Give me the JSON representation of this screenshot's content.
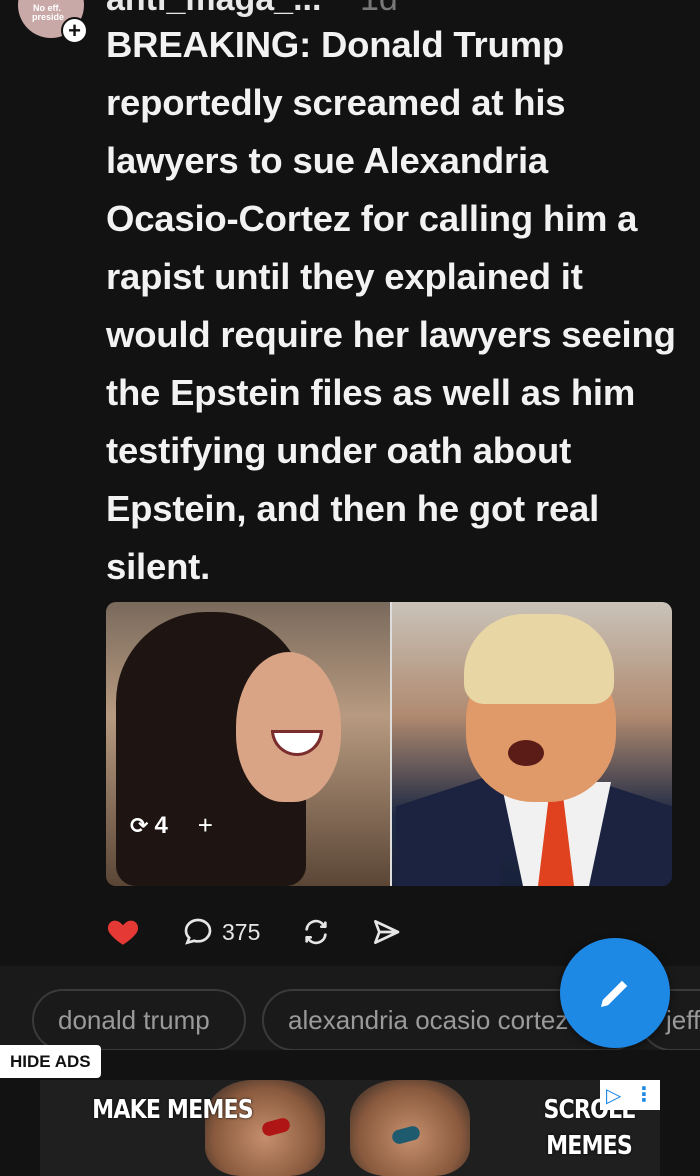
{
  "post": {
    "username": "anti_maga_...",
    "age": "1d",
    "title": "BREAKING: Donald Trump reportedly screamed at his lawyers to sue Alexandria Ocasio-Cortez for calling him a rapist until they explained it would require her lawyers seeing the Epstein files as well as him testifying under oath about Epstein, and then he got real silent.",
    "avatar_text": "No eff. preside",
    "follow_label": "+",
    "image_overlay": {
      "repost_count": "4",
      "add_label": "+"
    },
    "actions": {
      "comment_count": "375"
    }
  },
  "tags": [
    "donald trump",
    "alexandria ocasio cortez",
    "jeffrey epstein"
  ],
  "ads": {
    "hide_label": "HIDE ADS",
    "banner_left": "MAKE MEMES",
    "banner_right": "SCROLL MEMES"
  },
  "colors": {
    "background": "#121212",
    "heart": "#e53935",
    "fab": "#1e88e5",
    "tie": "#e0411f"
  },
  "icons": {
    "heart": "heart-icon",
    "comment": "comment-icon",
    "share": "repost-icon",
    "send": "send-icon",
    "fab": "pencil-icon",
    "follow": "plus-icon"
  }
}
